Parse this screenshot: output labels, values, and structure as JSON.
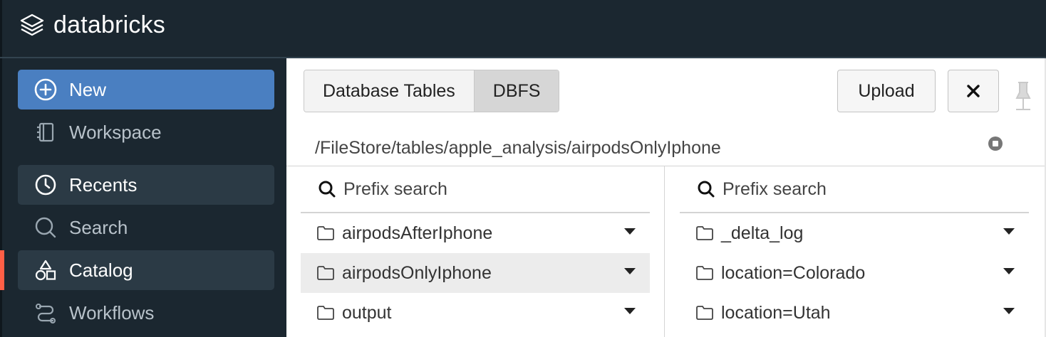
{
  "app": {
    "brand": "databricks",
    "colors": {
      "topbar": "#1b2730",
      "new_button": "#4a7fc1",
      "active_item": "#2b3a45",
      "accent": "#ff5f46"
    }
  },
  "sidebar": {
    "new_label": "New",
    "items": [
      {
        "label": "Workspace",
        "icon": "workspace-icon",
        "active": false
      },
      {
        "label": "Recents",
        "icon": "clock-icon",
        "active": true
      },
      {
        "label": "Search",
        "icon": "search-icon",
        "active": false
      },
      {
        "label": "Catalog",
        "icon": "catalog-shapes-icon",
        "active": true
      },
      {
        "label": "Workflows",
        "icon": "workflows-icon",
        "active": false
      }
    ]
  },
  "panel": {
    "tabs": [
      {
        "label": "Database Tables",
        "selected": false
      },
      {
        "label": "DBFS",
        "selected": true
      }
    ],
    "upload_label": "Upload",
    "path": "/FileStore/tables/apple_analysis/airpodsOnlyIphone",
    "left_column": {
      "search_placeholder": "Prefix search",
      "items": [
        {
          "name": "airpodsAfterIphone",
          "selected": false
        },
        {
          "name": "airpodsOnlyIphone",
          "selected": true
        },
        {
          "name": "output",
          "selected": false
        }
      ]
    },
    "right_column": {
      "search_placeholder": "Prefix search",
      "items": [
        {
          "name": "_delta_log"
        },
        {
          "name": "location=Colorado"
        },
        {
          "name": "location=Utah"
        }
      ]
    }
  }
}
